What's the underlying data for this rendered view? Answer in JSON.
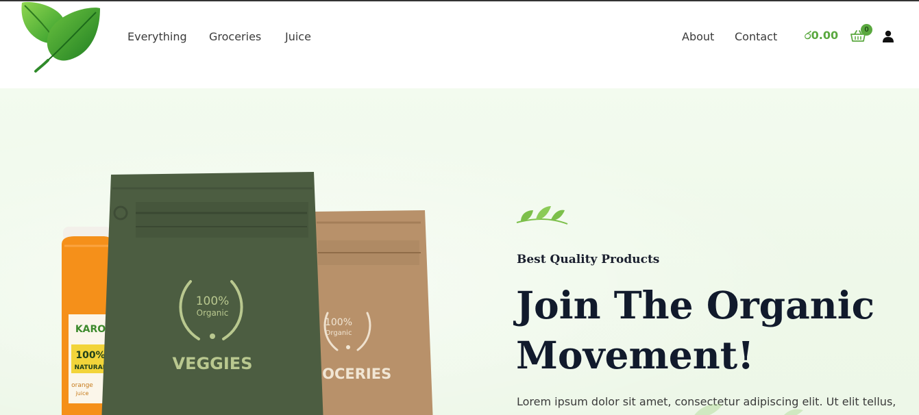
{
  "header": {
    "nav_left": [
      "Everything",
      "Groceries",
      "Juice"
    ],
    "nav_right": [
      "About",
      "Contact"
    ],
    "cart_total": "ර0.00",
    "cart_count": "0"
  },
  "hero": {
    "eyebrow": "Best Quality Products",
    "headline_line1": "Join The Organic",
    "headline_line2": "Movement!",
    "body": "Lorem ipsum dolor sit amet, consectetur adipiscing elit. Ut elit tellus,",
    "products": {
      "front_bag_badge_pct": "100%",
      "front_bag_badge_word": "Organic",
      "front_bag_label": "VEGGIES",
      "back_bag_badge_pct": "100%",
      "back_bag_badge_word": "Organic",
      "back_bag_label": "GROCERIES",
      "jar_brand": "KARO",
      "jar_label_big": "100%",
      "jar_label_sub": "NATURAL",
      "jar_flavor": "orange",
      "jar_type": "juice"
    }
  },
  "colors": {
    "accent_green": "#5aa83f",
    "headline": "#111a2c",
    "hero_bg": "#eef8e9"
  },
  "icons": [
    "leaf-logo-icon",
    "shopping-basket-icon",
    "user-icon",
    "leaf-sprig-icon"
  ]
}
